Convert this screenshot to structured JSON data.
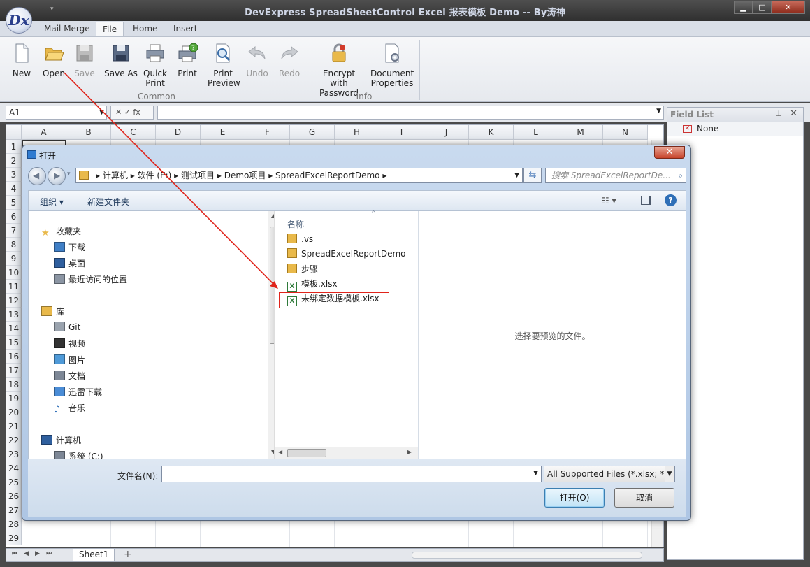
{
  "app": {
    "title": "DevExpress SpreadSheetControl Excel 报表模板 Demo -- By涛神",
    "logo_text": "Dx",
    "window_buttons": [
      "▁",
      "□",
      "✕"
    ]
  },
  "ribbon": {
    "tabs": [
      "Mail Merge",
      "File",
      "Home",
      "Insert"
    ],
    "active_tab": "File",
    "groups": [
      {
        "label": "Common",
        "buttons": [
          {
            "label": "New",
            "icon": "new-document-icon",
            "enabled": true
          },
          {
            "label": "Open",
            "icon": "open-folder-icon",
            "enabled": true
          },
          {
            "label": "Save",
            "icon": "save-disk-icon",
            "enabled": false
          },
          {
            "label": "Save As",
            "icon": "save-as-icon",
            "enabled": true
          },
          {
            "label": "Quick Print",
            "icon": "quick-print-icon",
            "enabled": true
          },
          {
            "label": "Print",
            "icon": "print-icon",
            "enabled": true
          },
          {
            "label": "Print Preview",
            "icon": "print-preview-icon",
            "enabled": true
          },
          {
            "label": "Undo",
            "icon": "undo-icon",
            "enabled": false
          },
          {
            "label": "Redo",
            "icon": "redo-icon",
            "enabled": false
          }
        ]
      },
      {
        "label": "Info",
        "buttons": [
          {
            "label": "Encrypt with Password",
            "icon": "encrypt-lock-icon",
            "enabled": true
          },
          {
            "label": "Document Properties",
            "icon": "document-properties-icon",
            "enabled": true
          }
        ]
      }
    ]
  },
  "formula_bar": {
    "cell_ref": "A1",
    "fx_label": "✕ ✓ fx",
    "value": ""
  },
  "sheet": {
    "columns": [
      "A",
      "B",
      "C",
      "D",
      "E",
      "F",
      "G",
      "H",
      "I",
      "J",
      "K",
      "L",
      "M",
      "N"
    ],
    "rows": [
      "1",
      "2",
      "3",
      "4",
      "5",
      "6",
      "7",
      "8",
      "9",
      "10",
      "11",
      "12",
      "13",
      "14",
      "15",
      "16",
      "17",
      "18",
      "19",
      "20",
      "21",
      "22",
      "23",
      "24",
      "25",
      "26",
      "27",
      "28",
      "29"
    ],
    "tabs": [
      "Sheet1"
    ],
    "add_tab": "+"
  },
  "field_list": {
    "title": "Field List",
    "items": [
      "None"
    ]
  },
  "dialog": {
    "title": "打开",
    "close": "✕",
    "breadcrumb": [
      "计算机",
      "软件 (E:)",
      "测试项目",
      "Demo项目",
      "SpreadExcelReportDemo"
    ],
    "search_placeholder": "搜索 SpreadExcelReportDe...",
    "toolbar": {
      "organize": "组织 ▾",
      "new_folder": "新建文件夹"
    },
    "nav": [
      {
        "label": "收藏夹",
        "icon": "star-icon",
        "level": 0
      },
      {
        "label": "下载",
        "icon": "download-folder-icon",
        "level": 1
      },
      {
        "label": "桌面",
        "icon": "desktop-icon",
        "level": 1
      },
      {
        "label": "最近访问的位置",
        "icon": "recent-places-icon",
        "level": 1
      },
      {
        "label": "库",
        "icon": "library-icon",
        "level": 0
      },
      {
        "label": "Git",
        "icon": "git-library-icon",
        "level": 1
      },
      {
        "label": "视频",
        "icon": "video-icon",
        "level": 1
      },
      {
        "label": "图片",
        "icon": "picture-icon",
        "level": 1
      },
      {
        "label": "文档",
        "icon": "documents-icon",
        "level": 1
      },
      {
        "label": "迅雷下载",
        "icon": "thunder-download-icon",
        "level": 1
      },
      {
        "label": "音乐",
        "icon": "music-icon",
        "level": 1
      },
      {
        "label": "计算机",
        "icon": "computer-icon",
        "level": 0
      },
      {
        "label": "系统 (C:)",
        "icon": "drive-icon",
        "level": 1
      }
    ],
    "column_header": "名称",
    "files": [
      {
        "name": ".vs",
        "type": "folder"
      },
      {
        "name": "SpreadExcelReportDemo",
        "type": "folder"
      },
      {
        "name": "步骤",
        "type": "folder"
      },
      {
        "name": "模板.xlsx",
        "type": "excel"
      },
      {
        "name": "未绑定数据模板.xlsx",
        "type": "excel",
        "highlighted": true
      }
    ],
    "preview_text": "选择要预览的文件。",
    "filename_label": "文件名(N):",
    "filename_value": "",
    "filter": "All Supported Files (*.xlsx; *.◦",
    "open_button": "打开(O)",
    "cancel_button": "取消"
  },
  "colors": {
    "annotation": "#e0241b",
    "dialog_frame": "#aec6e4",
    "accent": "#1e395b"
  }
}
